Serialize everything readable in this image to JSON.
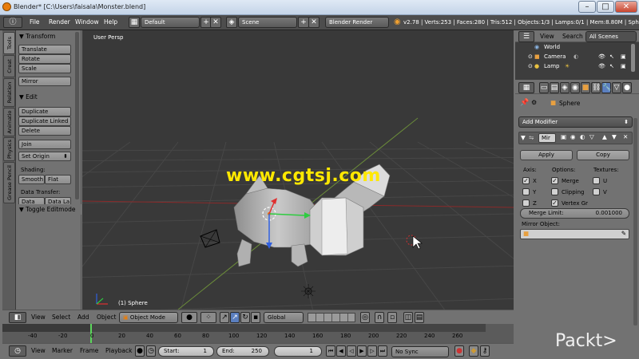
{
  "window": {
    "title": "Blender* [C:\\Users\\faisala\\Monster.blend]"
  },
  "info_bar": {
    "menus": [
      "File",
      "Render",
      "Window",
      "Help"
    ],
    "layout": "Default",
    "scene": "Scene",
    "engine": "Blender Render",
    "stats": "v2.78 | Verts:253 | Faces:280 | Tris:512 | Objects:1/3 | Lamps:0/1 | Mem:8.80M | Sphere"
  },
  "tool_tabs": [
    "Tools",
    "Creat",
    "Relation",
    "Animatio",
    "Physics",
    "Grease Pencil"
  ],
  "tool_shelf": {
    "transform": {
      "header": "Transform",
      "buttons": [
        "Translate",
        "Rotate",
        "Scale",
        "Mirror"
      ]
    },
    "edit": {
      "header": "Edit",
      "buttons": [
        "Duplicate",
        "Duplicate Linked",
        "Delete",
        "Join",
        "Set Origin"
      ]
    },
    "shading": {
      "label": "Shading:",
      "buttons": [
        "Smooth",
        "Flat"
      ]
    },
    "data_transfer": {
      "label": "Data Transfer:",
      "buttons": [
        "Data",
        "Data La"
      ]
    },
    "toggle": "Toggle Editmode"
  },
  "viewport": {
    "view_label": "User Persp",
    "object_label": "(1) Sphere"
  },
  "viewport_header": {
    "menus": [
      "View",
      "Select",
      "Add",
      "Object"
    ],
    "mode": "Object Mode",
    "orientation": "Global"
  },
  "timeline": {
    "ticks": [
      "-40",
      "-20",
      "0",
      "20",
      "40",
      "60",
      "80",
      "100",
      "120",
      "140",
      "160",
      "180",
      "200",
      "220",
      "240",
      "260"
    ]
  },
  "bottom_bar": {
    "menus": [
      "View",
      "Marker",
      "Frame",
      "Playback"
    ],
    "start_label": "Start:",
    "start_value": "1",
    "end_label": "End:",
    "end_value": "250",
    "current_frame": "1",
    "sync": "No Sync"
  },
  "outliner": {
    "menus": [
      "View",
      "Search"
    ],
    "filter": "All Scenes",
    "items": [
      "World",
      "Camera",
      "Lamp"
    ]
  },
  "properties": {
    "breadcrumb": "Sphere",
    "add_modifier": "Add Modifier",
    "modifier_name": "Mir",
    "apply": "Apply",
    "copy": "Copy",
    "axis_label": "Axis:",
    "options_label": "Options:",
    "textures_label": "Textures:",
    "axis": [
      "X",
      "Y",
      "Z"
    ],
    "options": [
      "Merge",
      "Clipping",
      "Vertex Gr"
    ],
    "textures": [
      "U",
      "V"
    ],
    "merge_limit_label": "Merge Limit:",
    "merge_limit_value": "0.001000",
    "mirror_object_label": "Mirror Object:"
  },
  "overlays": {
    "watermark": "www.cgtsj.com",
    "brand": "Packt>"
  },
  "colors": {
    "viewport_bg": "#393939",
    "panel_bg": "#727272",
    "accent_orange": "#e87d0d",
    "watermark": "#ffe800"
  }
}
